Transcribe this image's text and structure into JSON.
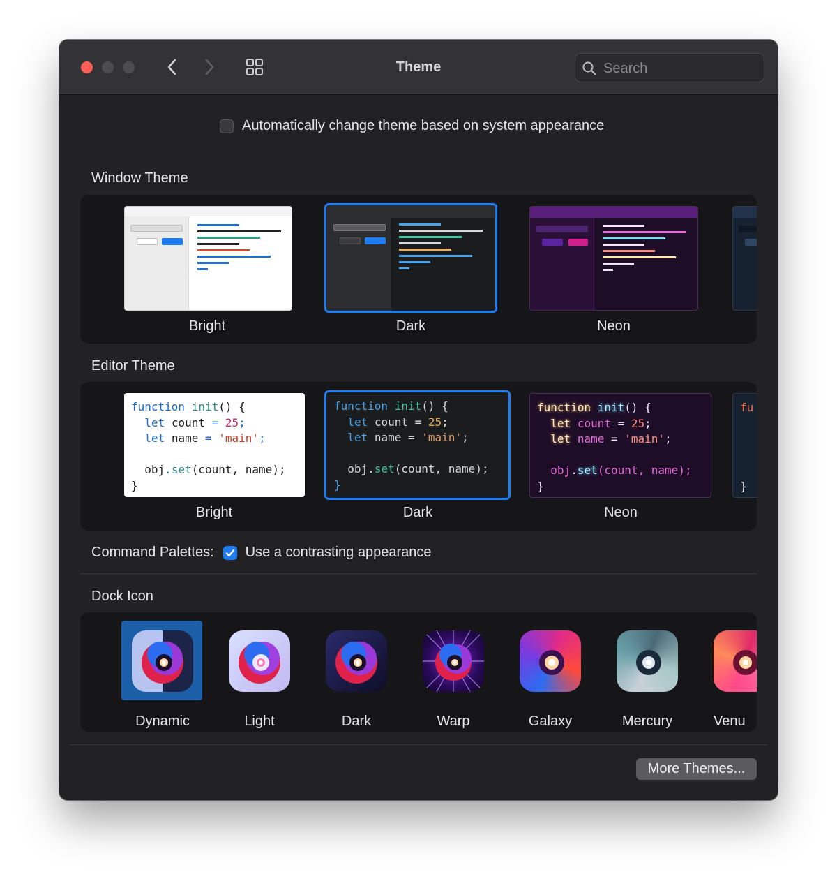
{
  "window": {
    "title": "Theme",
    "search_placeholder": "Search"
  },
  "auto_theme": {
    "label": "Automatically change theme based on system appearance",
    "checked": false
  },
  "window_theme": {
    "heading": "Window Theme",
    "items": [
      {
        "label": "Bright",
        "selected": false
      },
      {
        "label": "Dark",
        "selected": true
      },
      {
        "label": "Neon",
        "selected": false
      }
    ]
  },
  "editor_theme": {
    "heading": "Editor Theme",
    "items": [
      {
        "label": "Bright",
        "selected": false
      },
      {
        "label": "Dark",
        "selected": true
      },
      {
        "label": "Neon",
        "selected": false
      }
    ],
    "code_lines": {
      "l1a": "function",
      "l1b": "init",
      "l1c": "() {",
      "l2a": "let",
      "l2b": "count",
      "l2c": "=",
      "l2d": "25",
      "l2e": ";",
      "l3a": "let",
      "l3b": "name",
      "l3c": "=",
      "l3d": "'main'",
      "l3e": ";",
      "l4a": "obj",
      "l4b": ".",
      "l4c": "set",
      "l4d": "(count, name);",
      "l5": "}",
      "peek1": "fu",
      "peek2": "}"
    }
  },
  "command_palettes": {
    "label": "Command Palettes:",
    "option_label": "Use a contrasting appearance",
    "checked": true
  },
  "dock_icon": {
    "heading": "Dock Icon",
    "items": [
      {
        "label": "Dynamic",
        "selected": true
      },
      {
        "label": "Light",
        "selected": false
      },
      {
        "label": "Dark",
        "selected": false
      },
      {
        "label": "Warp",
        "selected": false
      },
      {
        "label": "Galaxy",
        "selected": false
      },
      {
        "label": "Mercury",
        "selected": false
      },
      {
        "label": "Venu",
        "selected": false
      }
    ]
  },
  "footer": {
    "more_themes_label": "More Themes..."
  },
  "colors": {
    "accent": "#1f7cf0",
    "close_light": "#fe5f57",
    "panel_bg": "#161618",
    "window_bg": "#222224"
  }
}
